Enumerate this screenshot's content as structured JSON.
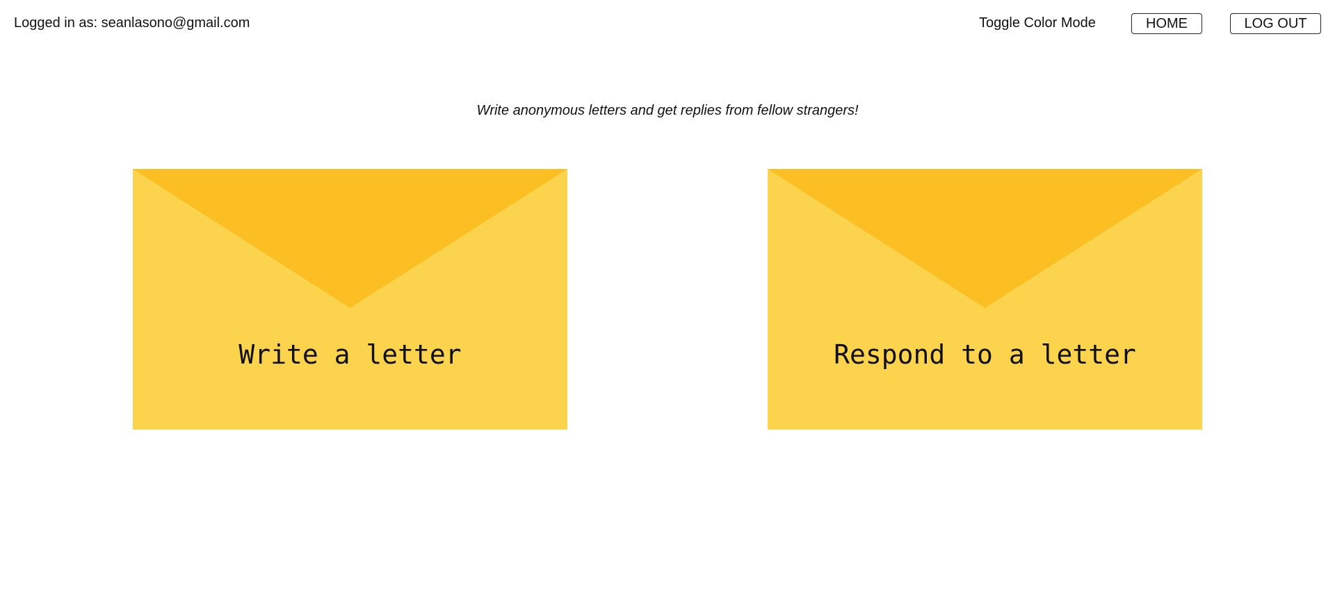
{
  "header": {
    "login_status": "Logged in as: seanlasono@gmail.com",
    "toggle_color_mode": "Toggle Color Mode",
    "home_button": "HOME",
    "logout_button": "LOG OUT"
  },
  "main": {
    "tagline": "Write anonymous letters and get replies from fellow strangers!",
    "cards": [
      {
        "label": "Write a letter",
        "icon": "envelope-icon"
      },
      {
        "label": "Respond to a letter",
        "icon": "envelope-icon"
      }
    ]
  },
  "colors": {
    "envelope_body": "#fcd34d",
    "envelope_flap": "#fbbf24",
    "background": "#ffffff",
    "text": "#111111"
  }
}
